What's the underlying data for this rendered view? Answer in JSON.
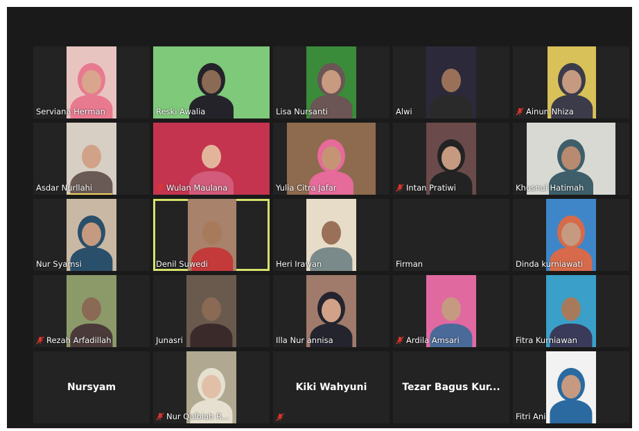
{
  "participants": [
    {
      "name": "Serviana Herman",
      "muted": false,
      "video": true,
      "bg": "#e8c4c0",
      "skin": "#d9a58c",
      "cloth": "#e8728a",
      "hijab": "#e87a90",
      "vx": 48,
      "vw": 72
    },
    {
      "name": "Reski Awalia",
      "muted": false,
      "video": true,
      "bg": "#7fc97a",
      "skin": "#8a6a55",
      "cloth": "#2a2a30",
      "hijab": "#24232a",
      "vx": 0,
      "vw": 168
    },
    {
      "name": "Lisa Nursanti",
      "muted": false,
      "video": true,
      "bg": "#3a8c3a",
      "skin": "#c89a80",
      "cloth": "#5a4a4a",
      "hijab": "#6b5555",
      "vx": 48,
      "vw": 72
    },
    {
      "name": "Alwi",
      "muted": false,
      "video": true,
      "bg": "#2c2a3a",
      "skin": "#9a7058",
      "cloth": "#2a2a2a",
      "hijab": "",
      "vx": 48,
      "vw": 72
    },
    {
      "name": "Ainun Nhiza",
      "muted": true,
      "video": true,
      "bg": "#d9c15a",
      "skin": "#c59a80",
      "cloth": "#3b3b4a",
      "hijab": "#3b3b4a",
      "vx": 50,
      "vw": 70
    },
    {
      "name": "Asdar Nurllahi",
      "muted": false,
      "video": true,
      "bg": "#d7cfc4",
      "skin": "#d1a287",
      "cloth": "#6a5a55",
      "hijab": "",
      "vx": 48,
      "vw": 72
    },
    {
      "name": "Wulan Maulana",
      "muted": true,
      "video": true,
      "bg": "#c4344f",
      "skin": "#e2b59a",
      "cloth": "#d25a7a",
      "hijab": "",
      "vx": 0,
      "vw": 168
    },
    {
      "name": "Yulia Citra Jafar",
      "muted": false,
      "video": true,
      "bg": "#8e6b4e",
      "skin": "#c59475",
      "cloth": "#2d2d2d",
      "hijab": "#e66a9a",
      "vx": 20,
      "vw": 128
    },
    {
      "name": "Intan Pratiwi",
      "muted": true,
      "video": true,
      "bg": "#6a4a4a",
      "skin": "#c59a80",
      "cloth": "#2b2b2b",
      "hijab": "#232323",
      "vx": 48,
      "vw": 72
    },
    {
      "name": "Khusnul Hatimah",
      "muted": false,
      "video": true,
      "bg": "#d9d9d4",
      "skin": "#b88a70",
      "cloth": "#3e6a6a",
      "hijab": "#3e5f6a",
      "vx": 20,
      "vw": 128
    },
    {
      "name": "Nur Syamsi",
      "muted": false,
      "video": true,
      "bg": "#c9b9a4",
      "skin": "#c59a80",
      "cloth": "#3a6a8a",
      "hijab": "#2a4f6a",
      "vx": 48,
      "vw": 72
    },
    {
      "name": "Denil Suwedi",
      "muted": false,
      "video": true,
      "active": true,
      "bg": "#a8826a",
      "skin": "#a87a5c",
      "cloth": "#c43a3a",
      "hijab": "",
      "vx": 50,
      "vw": 70
    },
    {
      "name": "Heri Irawan",
      "muted": false,
      "video": true,
      "bg": "#e6dcc8",
      "skin": "#9a7058",
      "cloth": "#7a8a8a",
      "hijab": "",
      "vx": 48,
      "vw": 72
    },
    {
      "name": "Firman",
      "muted": false,
      "video": false,
      "bg": "",
      "skin": "",
      "cloth": "",
      "hijab": "",
      "vx": 0,
      "vw": 0
    },
    {
      "name": "Dinda kurniawati",
      "muted": false,
      "video": true,
      "bg": "#3f86c9",
      "skin": "#c59a80",
      "cloth": "#c25a5a",
      "hijab": "#d66a4a",
      "vx": 48,
      "vw": 72
    },
    {
      "name": "Rezah Arfadillah",
      "muted": true,
      "video": true,
      "bg": "#8c9a6a",
      "skin": "#8a6a55",
      "cloth": "#4a3a3a",
      "hijab": "",
      "vx": 48,
      "vw": 72
    },
    {
      "name": "Junasri",
      "muted": false,
      "video": true,
      "bg": "#6a5a4e",
      "skin": "#8a6a55",
      "cloth": "#3a2a2a",
      "hijab": "",
      "vx": 48,
      "vw": 72
    },
    {
      "name": "Illa Nur annisa",
      "muted": false,
      "video": true,
      "bg": "#a07a6a",
      "skin": "#d1a287",
      "cloth": "#2a2a32",
      "hijab": "#24242e",
      "vx": 48,
      "vw": 72
    },
    {
      "name": "Ardila Amsari",
      "muted": true,
      "video": true,
      "bg": "#e06aa0",
      "skin": "#c59a80",
      "cloth": "#4a6a9a",
      "hijab": "",
      "vx": 48,
      "vw": 72
    },
    {
      "name": "Fitra Kurniawan",
      "muted": false,
      "video": true,
      "bg": "#3aa0c9",
      "skin": "#a87a5c",
      "cloth": "#3a3a5a",
      "hijab": "",
      "vx": 48,
      "vw": 72
    },
    {
      "name": "Nursyam",
      "muted": false,
      "video": false,
      "center": true,
      "bg": "",
      "skin": "",
      "cloth": "",
      "hijab": "",
      "vx": 0,
      "vw": 0
    },
    {
      "name": "Nur Qalbiah R...",
      "muted": true,
      "video": true,
      "bg": "#b0a890",
      "skin": "#e2c0a8",
      "cloth": "#d2c8b2",
      "hijab": "#e6e0d0",
      "vx": 48,
      "vw": 72
    },
    {
      "name": "Kiki Wahyuni",
      "muted": true,
      "video": false,
      "center": true,
      "bg": "",
      "skin": "",
      "cloth": "",
      "hijab": "",
      "vx": 0,
      "vw": 0
    },
    {
      "name": "Tezar Bagus Kur...",
      "muted": false,
      "video": false,
      "center": true,
      "bg": "",
      "skin": "",
      "cloth": "",
      "hijab": "",
      "vx": 0,
      "vw": 0
    },
    {
      "name": "Fitri Ani",
      "muted": false,
      "video": true,
      "bg": "#f2f2f2",
      "skin": "#c59a80",
      "cloth": "#3a8ac9",
      "hijab": "#2a6aa0",
      "vx": 48,
      "vw": 72
    }
  ],
  "colors": {
    "window_bg": "#1a1a1a",
    "tile_bg": "#232323",
    "active_border": "#d7e26a",
    "mute_red": "#e0342c"
  }
}
